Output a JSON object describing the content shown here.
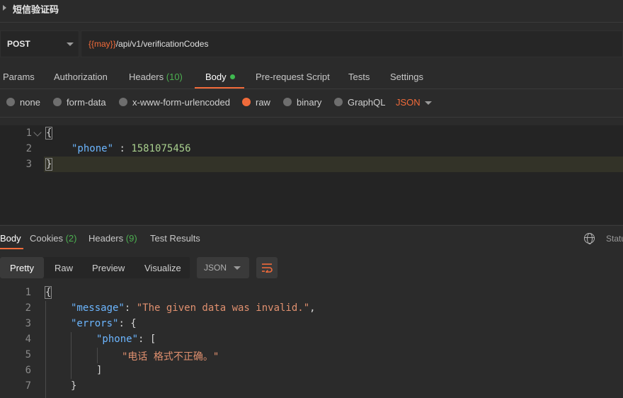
{
  "request": {
    "name": "短信验证码",
    "method": "POST",
    "url_var": "{{may}}",
    "url_path": "/api/v1/verificationCodes"
  },
  "request_tabs": [
    {
      "label": "Params"
    },
    {
      "label": "Authorization"
    },
    {
      "label": "Headers",
      "count": "(10)"
    },
    {
      "label": "Body"
    },
    {
      "label": "Pre-request Script"
    },
    {
      "label": "Tests"
    },
    {
      "label": "Settings"
    }
  ],
  "body_types": [
    {
      "label": "none"
    },
    {
      "label": "form-data"
    },
    {
      "label": "x-www-form-urlencoded"
    },
    {
      "label": "raw",
      "selected": true
    },
    {
      "label": "binary"
    },
    {
      "label": "GraphQL"
    }
  ],
  "body_format": "JSON",
  "request_body": {
    "line_numbers": [
      "1",
      "2",
      "3"
    ],
    "open": "{",
    "key": "\"phone\"",
    "colon": " : ",
    "value": "1581075456",
    "close": "}"
  },
  "response_tabs": [
    {
      "label": "Body"
    },
    {
      "label": "Cookies",
      "count": "(2)"
    },
    {
      "label": "Headers",
      "count": "(9)"
    },
    {
      "label": "Test Results"
    }
  ],
  "status_label": "Statu",
  "view_options": [
    "Pretty",
    "Raw",
    "Preview",
    "Visualize"
  ],
  "response_format": "JSON",
  "response_body": {
    "line_numbers": [
      "1",
      "2",
      "3",
      "4",
      "5",
      "6",
      "7"
    ],
    "l1": "{",
    "message_key": "\"message\"",
    "message_value": "\"The given data was invalid.\"",
    "errors_key": "\"errors\"",
    "phone_key": "\"phone\"",
    "phone_value": "\"电话 格式不正确。\"",
    "l6": "]",
    "l7": "}"
  },
  "colors": {
    "accent": "#f26b3a",
    "count_green": "#4caf50",
    "json_key": "#6cb6ff",
    "json_string": "#e0906f",
    "json_number": "#a9d08e"
  }
}
